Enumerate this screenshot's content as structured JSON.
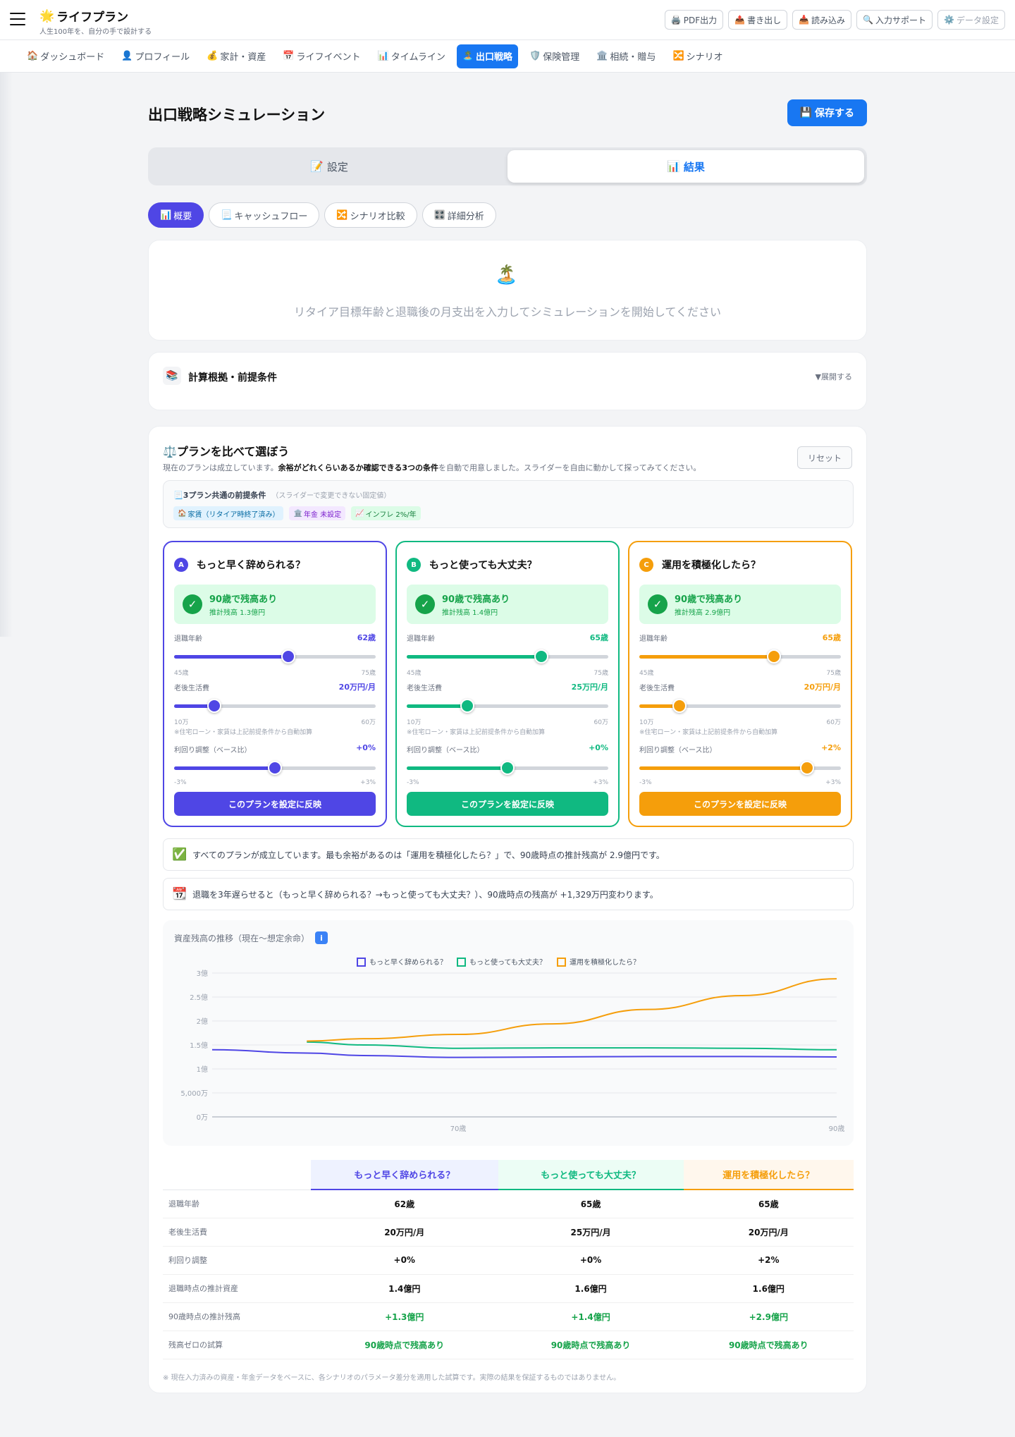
{
  "app": {
    "title": "ライフプラン",
    "subtitle": "人生100年を、自分の手で設計する"
  },
  "toolbar": [
    {
      "label": "PDF出力",
      "icon": "🖨️"
    },
    {
      "label": "書き出し",
      "icon": "📤"
    },
    {
      "label": "読み込み",
      "icon": "📥"
    },
    {
      "label": "入力サポート",
      "icon": "🔍"
    },
    {
      "label": "データ設定",
      "icon": "⚙️"
    }
  ],
  "nav": [
    {
      "label": "ダッシュボード",
      "icon": "🏠"
    },
    {
      "label": "プロフィール",
      "icon": "👤"
    },
    {
      "label": "家計・資産",
      "icon": "💰"
    },
    {
      "label": "ライフイベント",
      "icon": "📅"
    },
    {
      "label": "タイムライン",
      "icon": "📊"
    },
    {
      "label": "出口戦略",
      "icon": "🏝️",
      "active": true
    },
    {
      "label": "保険管理",
      "icon": "🛡️"
    },
    {
      "label": "相続・贈与",
      "icon": "🏛️"
    },
    {
      "label": "シナリオ",
      "icon": "🔀"
    }
  ],
  "page": {
    "title": "出口戦略シミュレーション",
    "save_label": "保存する",
    "save_icon": "💾"
  },
  "segment": {
    "settings": "設定",
    "settings_icon": "📝",
    "results": "結果",
    "results_icon": "📊"
  },
  "subtabs": [
    {
      "label": "概要",
      "icon": "📊",
      "active": true
    },
    {
      "label": "キャッシュフロー",
      "icon": "📃"
    },
    {
      "label": "シナリオ比較",
      "icon": "🔀"
    },
    {
      "label": "詳細分析",
      "icon": "🎛️"
    }
  ],
  "empty": {
    "icon": "🏝️",
    "message": "リタイア目標年齢と退職後の月支出を入力してシミュレーションを開始してください"
  },
  "assumptions": {
    "icon": "📚",
    "title": "計算根拠・前提条件",
    "expand": "▼展開する"
  },
  "compare": {
    "icon": "⚖️",
    "title": "プランを比べて選ぼう",
    "desc_pre": "現在のプランは成立しています。",
    "desc_bold": "余裕がどれくらいあるか確認できる3つの条件",
    "desc_post": "を自動で用意しました。スライダーを自由に動かして探ってみてください。",
    "reset": "リセット",
    "premise_title": "3プラン共通の前提条件",
    "premise_icon": "📃",
    "premise_note": "（スライダーで変更できない固定値）",
    "chips": [
      {
        "icon": "🏠",
        "label": "家賃（リタイア時終了済み）",
        "bg": "#e0f2fe",
        "fg": "#0369a1"
      },
      {
        "icon": "🏛️",
        "label": "年金 未設定",
        "bg": "#f3e8ff",
        "fg": "#7e22ce"
      },
      {
        "icon": "📈",
        "label": "インフレ 2%/年",
        "bg": "#dcfce7",
        "fg": "#15803d"
      }
    ],
    "labels": {
      "age": "退職年齢",
      "age_min": "45歳",
      "age_max": "75歳",
      "spend": "老後生活費",
      "spend_min": "10万",
      "spend_max": "60万",
      "note": "※住宅ローン・家賃は上記前提条件から自動加算",
      "ret": "利回り調整（ベース比）",
      "ret_min": "-3%",
      "ret_max": "+3%",
      "apply": "このプランを設定に反映"
    },
    "plans": [
      {
        "badge": "A",
        "name": "もっと早く辞められる？",
        "color": "#4f46e5",
        "status": "90歳で残高あり",
        "sub": "推計残高 1.3億円",
        "age": "62歳",
        "age_num": 62,
        "spend": "20万円/月",
        "spend_num": 20,
        "ret": "+0%",
        "ret_num": 0
      },
      {
        "badge": "B",
        "name": "もっと使っても大丈夫？",
        "color": "#10b981",
        "status": "90歳で残高あり",
        "sub": "推計残高 1.4億円",
        "age": "65歳",
        "age_num": 65,
        "spend": "25万円/月",
        "spend_num": 25,
        "ret": "+0%",
        "ret_num": 0
      },
      {
        "badge": "C",
        "name": "運用を積極化したら？",
        "color": "#f59e0b",
        "status": "90歳で残高あり",
        "sub": "推計残高 2.9億円",
        "age": "65歳",
        "age_num": 65,
        "spend": "20万円/月",
        "spend_num": 20,
        "ret": "+2%",
        "ret_num": 2
      }
    ],
    "insight1": {
      "icon": "✅",
      "text": "すべてのプランが成立しています。最も余裕があるのは「運用を積極化したら？」で、90歳時点の推計残高が 2.9億円です。"
    },
    "insight2": {
      "icon": "📆",
      "text": "退職を3年遅らせると（もっと早く辞められる？→もっと使っても大丈夫？）、90歳時点の残高が +1,329万円変わります。"
    },
    "chart_title": "資産残高の推移（現在〜想定余命）",
    "chart_info_icon": "ℹ️",
    "table": {
      "rows": [
        {
          "label": "退職年齢",
          "values": [
            "62歳",
            "65歳",
            "65歳"
          ]
        },
        {
          "label": "老後生活費",
          "values": [
            "20万円/月",
            "25万円/月",
            "20万円/月"
          ]
        },
        {
          "label": "利回り調整",
          "values": [
            "+0%",
            "+0%",
            "+2%"
          ]
        },
        {
          "label": "退職時点の推計資産",
          "values": [
            "1.4億円",
            "1.6億円",
            "1.6億円"
          ]
        },
        {
          "label": "90歳時点の推計残高",
          "values": [
            "+1.3億円",
            "+1.4億円",
            "+2.9億円"
          ],
          "green": true
        },
        {
          "label": "残高ゼロの試算",
          "values": [
            "90歳時点で残高あり",
            "90歳時点で残高あり",
            "90歳時点で残高あり"
          ],
          "green": true
        }
      ]
    },
    "footnote": "※ 現在入力済みの資産・年金データをベースに、各シナリオのパラメータ差分を適用した試算です。実際の結果を保証するものではありません。"
  },
  "chart_data": {
    "type": "line",
    "title": "資産残高の推移（現在〜想定余命）",
    "xlabel": "",
    "ylabel": "",
    "x": [
      57,
      62,
      65,
      70,
      75,
      80,
      85,
      90
    ],
    "x_ticks": [
      {
        "v": 70,
        "label": "70歳"
      },
      {
        "v": 90,
        "label": "90歳"
      }
    ],
    "y_ticks": [
      {
        "v": 0,
        "label": "0万"
      },
      {
        "v": 0.5,
        "label": "5,000万"
      },
      {
        "v": 1,
        "label": "1億"
      },
      {
        "v": 1.5,
        "label": "1.5億"
      },
      {
        "v": 2,
        "label": "2億"
      },
      {
        "v": 2.5,
        "label": "2.5億"
      },
      {
        "v": 3,
        "label": "3億"
      }
    ],
    "xlim": [
      57,
      90
    ],
    "ylim": [
      0,
      3
    ],
    "unit": "億円",
    "legend_position": "top",
    "series": [
      {
        "name": "もっと早く辞められる？",
        "color": "#4f46e5",
        "x": [
          57,
          62,
          65,
          70,
          75,
          80,
          85,
          90
        ],
        "values": [
          1.4,
          1.33,
          1.28,
          1.24,
          1.25,
          1.26,
          1.26,
          1.25
        ]
      },
      {
        "name": "もっと使っても大丈夫？",
        "color": "#10b981",
        "x": [
          62,
          65,
          70,
          75,
          80,
          85,
          90
        ],
        "values": [
          1.56,
          1.5,
          1.43,
          1.44,
          1.44,
          1.43,
          1.4
        ]
      },
      {
        "name": "運用を積極化したら？",
        "color": "#f59e0b",
        "x": [
          62,
          65,
          70,
          75,
          80,
          85,
          90
        ],
        "values": [
          1.58,
          1.63,
          1.72,
          1.94,
          2.24,
          2.53,
          2.88
        ]
      }
    ]
  }
}
